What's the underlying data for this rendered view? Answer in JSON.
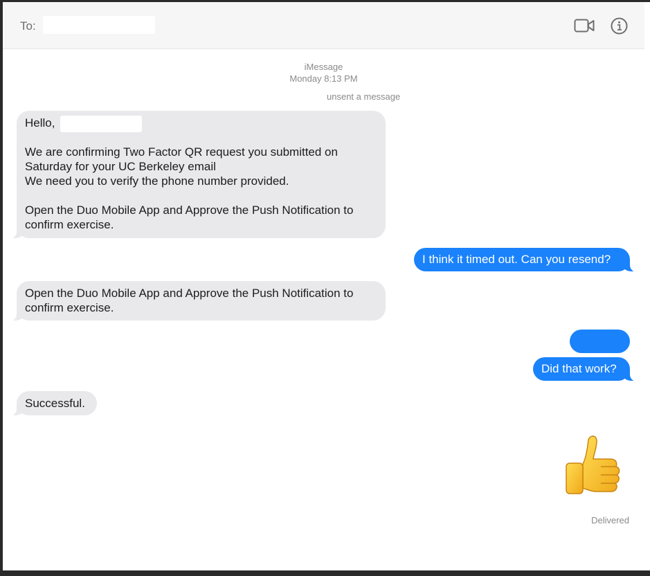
{
  "header": {
    "to_label": "To:",
    "icons": [
      "video-camera-icon",
      "info-icon"
    ]
  },
  "meta": {
    "service": "iMessage",
    "timestamp": "Monday 8:13 PM",
    "unsent_notice": "unsent a message"
  },
  "messages": [
    {
      "direction": "incoming",
      "text": "Hello,\n\nWe are confirming Two Factor QR request you submitted on\nSaturday for your UC Berkeley email\nWe need you to verify the phone number provided.\n\nOpen the Duo Mobile App and Approve the Push Notification to\nconfirm exercise."
    },
    {
      "direction": "outgoing",
      "text": "I think it timed out. Can you resend?"
    },
    {
      "direction": "incoming",
      "text": "Open the Duo Mobile App and Approve the Push Notification to\nconfirm exercise."
    },
    {
      "direction": "outgoing",
      "text": ""
    },
    {
      "direction": "outgoing",
      "text": "Did that work?"
    },
    {
      "direction": "incoming",
      "text": "Successful."
    },
    {
      "direction": "outgoing",
      "emoji": "thumbs-up-emoji"
    }
  ],
  "status": {
    "delivered": "Delivered"
  },
  "colors": {
    "outgoing_bubble": "#1a82fb",
    "incoming_bubble": "#e9e9eb",
    "header_bg": "#f6f6f6",
    "meta_text": "#8a8a8a"
  }
}
